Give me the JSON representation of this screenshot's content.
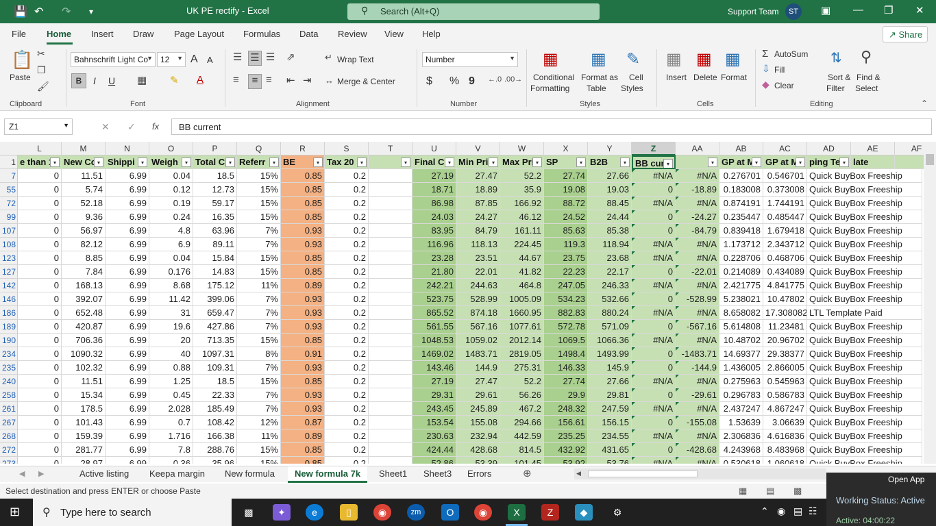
{
  "window": {
    "title": "UK PE rectify  -  Excel",
    "search_placeholder": "Search (Alt+Q)",
    "user_name": "Support Team",
    "user_initials": "ST"
  },
  "menu": {
    "items": [
      "File",
      "Home",
      "Insert",
      "Draw",
      "Page Layout",
      "Formulas",
      "Data",
      "Review",
      "View",
      "Help"
    ],
    "share": "Share"
  },
  "ribbon": {
    "clipboard": {
      "label": "Clipboard",
      "paste": "Paste"
    },
    "font": {
      "label": "Font",
      "name": "Bahnschrift Light Co",
      "size": "12",
      "bold": "B",
      "italic": "I",
      "underline": "U",
      "grow": "A",
      "shrink": "A"
    },
    "alignment": {
      "label": "Alignment",
      "wrap": "Wrap Text",
      "merge": "Merge & Center"
    },
    "number": {
      "label": "Number",
      "format": "Number",
      "currency": "$",
      "percent": "%",
      "comma": "9"
    },
    "styles": {
      "label": "Styles",
      "conditional": "Conditional",
      "conditional2": "Formatting",
      "format_table": "Format as",
      "format_table2": "Table",
      "cell_styles": "Cell",
      "cell_styles2": "Styles"
    },
    "cells": {
      "label": "Cells",
      "insert": "Insert",
      "delete": "Delete",
      "format": "Format"
    },
    "editing": {
      "label": "Editing",
      "autosum": "AutoSum",
      "fill": "Fill",
      "clear": "Clear",
      "sort": "Sort &",
      "sort2": "Filter",
      "find": "Find &",
      "find2": "Select"
    }
  },
  "formula_bar": {
    "name_box": "Z1",
    "fx": "fx",
    "content": "BB current"
  },
  "columns": [
    "L",
    "M",
    "N",
    "O",
    "P",
    "Q",
    "R",
    "S",
    "T",
    "U",
    "V",
    "W",
    "X",
    "Y",
    "Z",
    "AA",
    "AB",
    "AC",
    "AD",
    "AE",
    "AF"
  ],
  "header_row": {
    "row_num": "1",
    "cells": [
      "e than 1",
      "New Co",
      "Shippi",
      "Weigh",
      "Total C",
      "Referr",
      "BE",
      "Tax 20",
      "",
      "Final C",
      "Min Pri",
      "Max Pri",
      "SP",
      "B2B",
      "BB curr",
      "",
      "GP at M",
      "GP at M",
      "ping Te",
      "late",
      ""
    ]
  },
  "rows": [
    {
      "n": "7",
      "c": [
        "0",
        "11.51",
        "6.99",
        "0.04",
        "18.5",
        "15%",
        "0.85",
        "0.2",
        "",
        "27.19",
        "27.47",
        "52.2",
        "27.74",
        "27.66",
        "#N/A",
        "#N/A",
        "0.276701",
        "0.546701",
        "Quick BuyBox Freeship"
      ]
    },
    {
      "n": "55",
      "c": [
        "0",
        "5.74",
        "6.99",
        "0.12",
        "12.73",
        "15%",
        "0.85",
        "0.2",
        "",
        "18.71",
        "18.89",
        "35.9",
        "19.08",
        "19.03",
        "0",
        "-18.89",
        "0.183008",
        "0.373008",
        "Quick BuyBox Freeship"
      ]
    },
    {
      "n": "72",
      "c": [
        "0",
        "52.18",
        "6.99",
        "0.19",
        "59.17",
        "15%",
        "0.85",
        "0.2",
        "",
        "86.98",
        "87.85",
        "166.92",
        "88.72",
        "88.45",
        "#N/A",
        "#N/A",
        "0.874191",
        "1.744191",
        "Quick BuyBox Freeship"
      ]
    },
    {
      "n": "99",
      "c": [
        "0",
        "9.36",
        "6.99",
        "0.24",
        "16.35",
        "15%",
        "0.85",
        "0.2",
        "",
        "24.03",
        "24.27",
        "46.12",
        "24.52",
        "24.44",
        "0",
        "-24.27",
        "0.235447",
        "0.485447",
        "Quick BuyBox Freeship"
      ]
    },
    {
      "n": "107",
      "c": [
        "0",
        "56.97",
        "6.99",
        "4.8",
        "63.96",
        "7%",
        "0.93",
        "0.2",
        "",
        "83.95",
        "84.79",
        "161.11",
        "85.63",
        "85.38",
        "0",
        "-84.79",
        "0.839418",
        "1.679418",
        "Quick BuyBox Freeship"
      ]
    },
    {
      "n": "108",
      "c": [
        "0",
        "82.12",
        "6.99",
        "6.9",
        "89.11",
        "7%",
        "0.93",
        "0.2",
        "",
        "116.96",
        "118.13",
        "224.45",
        "119.3",
        "118.94",
        "#N/A",
        "#N/A",
        "1.173712",
        "2.343712",
        "Quick BuyBox Freeship"
      ]
    },
    {
      "n": "123",
      "c": [
        "0",
        "8.85",
        "6.99",
        "0.04",
        "15.84",
        "15%",
        "0.85",
        "0.2",
        "",
        "23.28",
        "23.51",
        "44.67",
        "23.75",
        "23.68",
        "#N/A",
        "#N/A",
        "0.228706",
        "0.468706",
        "Quick BuyBox Freeship"
      ]
    },
    {
      "n": "127",
      "c": [
        "0",
        "7.84",
        "6.99",
        "0.176",
        "14.83",
        "15%",
        "0.85",
        "0.2",
        "",
        "21.80",
        "22.01",
        "41.82",
        "22.23",
        "22.17",
        "0",
        "-22.01",
        "0.214089",
        "0.434089",
        "Quick BuyBox Freeship"
      ]
    },
    {
      "n": "142",
      "c": [
        "0",
        "168.13",
        "6.99",
        "8.68",
        "175.12",
        "11%",
        "0.89",
        "0.2",
        "",
        "242.21",
        "244.63",
        "464.8",
        "247.05",
        "246.33",
        "#N/A",
        "#N/A",
        "2.421775",
        "4.841775",
        "Quick BuyBox Freeship"
      ]
    },
    {
      "n": "146",
      "c": [
        "0",
        "392.07",
        "6.99",
        "11.42",
        "399.06",
        "7%",
        "0.93",
        "0.2",
        "",
        "523.75",
        "528.99",
        "1005.09",
        "534.23",
        "532.66",
        "0",
        "-528.99",
        "5.238021",
        "10.47802",
        "Quick BuyBox Freeship"
      ]
    },
    {
      "n": "186",
      "c": [
        "0",
        "652.48",
        "6.99",
        "31",
        "659.47",
        "7%",
        "0.93",
        "0.2",
        "",
        "865.52",
        "874.18",
        "1660.95",
        "882.83",
        "880.24",
        "#N/A",
        "#N/A",
        "8.658082",
        "17.308082",
        "LTL Template Paid"
      ]
    },
    {
      "n": "189",
      "c": [
        "0",
        "420.87",
        "6.99",
        "19.6",
        "427.86",
        "7%",
        "0.93",
        "0.2",
        "",
        "561.55",
        "567.16",
        "1077.61",
        "572.78",
        "571.09",
        "0",
        "-567.16",
        "5.614808",
        "11.23481",
        "Quick BuyBox Freeship"
      ]
    },
    {
      "n": "190",
      "c": [
        "0",
        "706.36",
        "6.99",
        "20",
        "713.35",
        "15%",
        "0.85",
        "0.2",
        "",
        "1048.53",
        "1059.02",
        "2012.14",
        "1069.5",
        "1066.36",
        "#N/A",
        "#N/A",
        "10.48702",
        "20.96702",
        "Quick BuyBox Freeship"
      ]
    },
    {
      "n": "234",
      "c": [
        "0",
        "1090.32",
        "6.99",
        "40",
        "1097.31",
        "8%",
        "0.91",
        "0.2",
        "",
        "1469.02",
        "1483.71",
        "2819.05",
        "1498.4",
        "1493.99",
        "0",
        "-1483.71",
        "14.69377",
        "29.38377",
        "Quick BuyBox Freeship"
      ]
    },
    {
      "n": "235",
      "c": [
        "0",
        "102.32",
        "6.99",
        "0.88",
        "109.31",
        "7%",
        "0.93",
        "0.2",
        "",
        "143.46",
        "144.9",
        "275.31",
        "146.33",
        "145.9",
        "0",
        "-144.9",
        "1.436005",
        "2.866005",
        "Quick BuyBox Freeship"
      ]
    },
    {
      "n": "240",
      "c": [
        "0",
        "11.51",
        "6.99",
        "1.25",
        "18.5",
        "15%",
        "0.85",
        "0.2",
        "",
        "27.19",
        "27.47",
        "52.2",
        "27.74",
        "27.66",
        "#N/A",
        "#N/A",
        "0.275963",
        "0.545963",
        "Quick BuyBox Freeship"
      ]
    },
    {
      "n": "258",
      "c": [
        "0",
        "15.34",
        "6.99",
        "0.45",
        "22.33",
        "7%",
        "0.93",
        "0.2",
        "",
        "29.31",
        "29.61",
        "56.26",
        "29.9",
        "29.81",
        "0",
        "-29.61",
        "0.296783",
        "0.586783",
        "Quick BuyBox Freeship"
      ]
    },
    {
      "n": "261",
      "c": [
        "0",
        "178.5",
        "6.99",
        "2.028",
        "185.49",
        "7%",
        "0.93",
        "0.2",
        "",
        "243.45",
        "245.89",
        "467.2",
        "248.32",
        "247.59",
        "#N/A",
        "#N/A",
        "2.437247",
        "4.867247",
        "Quick BuyBox Freeship"
      ]
    },
    {
      "n": "267",
      "c": [
        "0",
        "101.43",
        "6.99",
        "0.7",
        "108.42",
        "12%",
        "0.87",
        "0.2",
        "",
        "153.54",
        "155.08",
        "294.66",
        "156.61",
        "156.15",
        "0",
        "-155.08",
        "1.53639",
        "3.06639",
        "Quick BuyBox Freeship"
      ]
    },
    {
      "n": "268",
      "c": [
        "0",
        "159.39",
        "6.99",
        "1.716",
        "166.38",
        "11%",
        "0.89",
        "0.2",
        "",
        "230.63",
        "232.94",
        "442.59",
        "235.25",
        "234.55",
        "#N/A",
        "#N/A",
        "2.306836",
        "4.616836",
        "Quick BuyBox Freeship"
      ]
    },
    {
      "n": "272",
      "c": [
        "0",
        "281.77",
        "6.99",
        "7.8",
        "288.76",
        "15%",
        "0.85",
        "0.2",
        "",
        "424.44",
        "428.68",
        "814.5",
        "432.92",
        "431.65",
        "0",
        "-428.68",
        "4.243968",
        "8.483968",
        "Quick BuyBox Freeship"
      ]
    },
    {
      "n": "273",
      "c": [
        "0",
        "28.97",
        "6.99",
        "0.36",
        "35.96",
        "15%",
        "0.85",
        "0.2",
        "",
        "52.86",
        "53.39",
        "101.45",
        "53.92",
        "53.76",
        "#N/A",
        "#N/A",
        "0.530618",
        "1.060618",
        "Quick BuyBox Freeship"
      ]
    }
  ],
  "sheet_tabs": [
    "Active listing",
    "Keepa margin",
    "New formula",
    "New formula 7k",
    "Sheet1",
    "Sheet3",
    "Errors"
  ],
  "active_tab": "New formula 7k",
  "status": {
    "message": "Select destination and press ENTER or choose Paste"
  },
  "taskbar": {
    "search_placeholder": "Type here to search"
  },
  "popup": {
    "open_app": "Open App",
    "working_status": "Working Status: Active",
    "active_timer": "Active: 04:00:22"
  }
}
